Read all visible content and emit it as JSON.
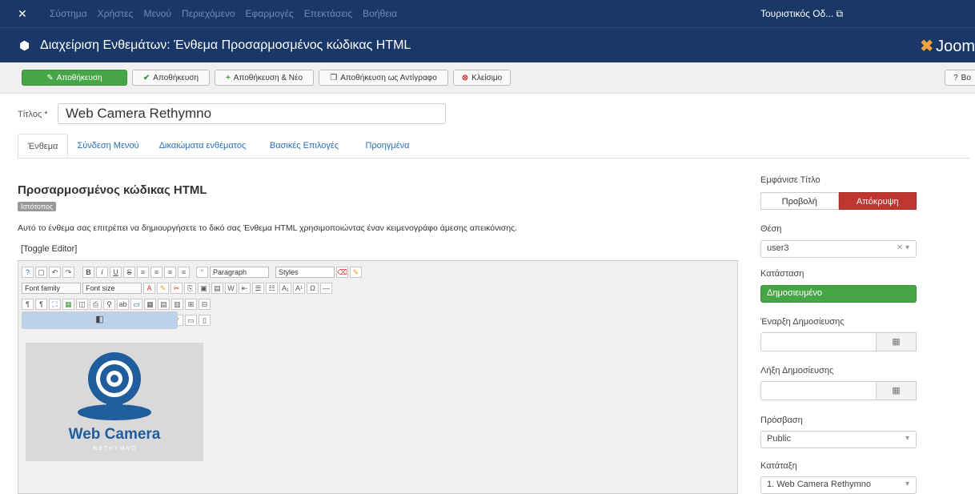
{
  "topbar": {
    "logo_icon": "joomla-x-icon",
    "menu": [
      "Σύστημα",
      "Χρήστες",
      "Μενού",
      "Περιεχόμενο",
      "Εφαρμογές",
      "Επεκτάσεις",
      "Βοήθεια"
    ],
    "site_link": "Τουριστικός Οδ... ⧉"
  },
  "header": {
    "title": "Διαχείριση Ενθεμάτων: Ένθεμα Προσαρμοσμένος κώδικας HTML",
    "brand": "Joom"
  },
  "toolbar": {
    "save": "Αποθήκευση",
    "save_close": "Αποθήκευση",
    "save_new": "Αποθήκευση & Νέο",
    "save_copy": "Αποθήκευση ως Αντίγραφο",
    "close": "Κλείσιμο",
    "help": "Βο"
  },
  "form": {
    "title_label": "Τίτλος *",
    "title_value": "Web Camera Rethymno"
  },
  "tabs": [
    "Ένθεμα",
    "Σύνδεση Μενού",
    "Δικαιώματα ενθέματος",
    "Βασικές Επιλογές",
    "Προηγμένα"
  ],
  "module": {
    "heading": "Προσαρμοσμένος κώδικας HTML",
    "badge": "Ιστότοπος",
    "description": "Αυτό το ένθεμα σας επιτρέπει να δημιουργήσετε το δικό σας Ένθεμα HTML χρησιμοποιώντας έναν κειμενογράφο άμεσης απεικόνισης.",
    "toggle": "[Toggle Editor]"
  },
  "editor": {
    "format_select": "Paragraph",
    "styles_select": "Styles",
    "font_family": "Font family",
    "font_size": "Font size"
  },
  "content_image": {
    "brand": "Web Camera",
    "sub": "R E T H Y M N O",
    "colors": {
      "bg": "#d9d9d9",
      "blue": "#1f5d9c"
    }
  },
  "sidebar": {
    "show_title_label": "Εμφάνισε Τίτλο",
    "show_title_options": [
      "Προβολή",
      "Απόκρυψη"
    ],
    "position_label": "Θέση",
    "position_value": "user3",
    "status_label": "Κατάσταση",
    "status_value": "Δημοσιευμένο",
    "publish_up_label": "Έναρξη Δημοσίευσης",
    "publish_down_label": "Λήξη Δημοσίευσης",
    "access_label": "Πρόσβαση",
    "access_value": "Public",
    "ordering_label": "Κατάταξη",
    "ordering_value": "1. Web Camera Rethymno"
  }
}
